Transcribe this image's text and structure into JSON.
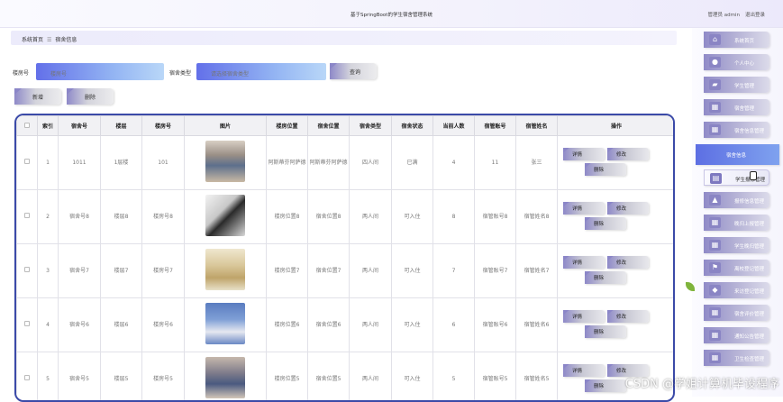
{
  "header": {
    "title": "基于SpringBoot的学生宿舍管理系统",
    "admin": "管理员 admin",
    "logout": "退出登录"
  },
  "breadcrumb": {
    "home": "系统首页",
    "sep": "☰",
    "current": "宿舍信息"
  },
  "search": {
    "room_label": "楼房号",
    "room_placeholder": "楼房号",
    "type_label": "宿舍类型",
    "type_placeholder": "请选择宿舍类型",
    "query": "查询"
  },
  "actions": {
    "add": "新增",
    "delete": "删除"
  },
  "table": {
    "columns": [
      "索引",
      "宿舍号",
      "楼层",
      "楼房号",
      "图片",
      "楼房位置",
      "宿舍位置",
      "宿舍类型",
      "宿舍状态",
      "当前人数",
      "宿管账号",
      "宿管姓名",
      "操作"
    ],
    "rows": [
      {
        "idx": "1",
        "room": "1011",
        "floor": "1层楼",
        "building": "101",
        "photo": "room-photo-1",
        "bpos": "阿斯蒂芬阿萨德",
        "rpos": "阿斯蒂芬阿萨德",
        "type": "四人间",
        "status": "已满",
        "count": "4",
        "acct": "11",
        "name": "张三"
      },
      {
        "idx": "2",
        "room": "宿舍号8",
        "floor": "楼层8",
        "building": "楼房号8",
        "photo": "room-photo-2",
        "bpos": "楼房位置8",
        "rpos": "宿舍位置8",
        "type": "两人间",
        "status": "可入住",
        "count": "8",
        "acct": "宿管账号8",
        "name": "宿管姓名8"
      },
      {
        "idx": "3",
        "room": "宿舍号7",
        "floor": "楼层7",
        "building": "楼房号7",
        "photo": "room-photo-3",
        "bpos": "楼房位置7",
        "rpos": "宿舍位置7",
        "type": "两人间",
        "status": "可入住",
        "count": "7",
        "acct": "宿管账号7",
        "name": "宿管姓名7"
      },
      {
        "idx": "4",
        "room": "宿舍号6",
        "floor": "楼层6",
        "building": "楼房号6",
        "photo": "room-photo-4",
        "bpos": "楼房位置6",
        "rpos": "宿舍位置6",
        "type": "两人间",
        "status": "可入住",
        "count": "6",
        "acct": "宿管账号6",
        "name": "宿管姓名6"
      },
      {
        "idx": "5",
        "room": "宿舍号5",
        "floor": "楼层5",
        "building": "楼房号5",
        "photo": "room-photo-5",
        "bpos": "楼房位置5",
        "rpos": "宿舍位置5",
        "type": "两人间",
        "status": "可入住",
        "count": "5",
        "acct": "宿管账号5",
        "name": "宿管姓名5"
      }
    ],
    "ops": {
      "detail": "详情",
      "edit": "修改",
      "delete": "删除"
    }
  },
  "sidebar": {
    "items": [
      {
        "label": "系统首页",
        "icon": "home-icon"
      },
      {
        "label": "个人中心",
        "icon": "user-icon"
      },
      {
        "label": "学生管理",
        "icon": "student-icon"
      },
      {
        "label": "宿舍管理",
        "icon": "grid-icon"
      },
      {
        "label": "宿舍信息管理",
        "icon": "grid-icon"
      },
      {
        "label": "宿舍信息",
        "icon": ""
      },
      {
        "label": "学生报修管理",
        "icon": "doc-icon"
      },
      {
        "label": "报修信息管理",
        "icon": "tool-icon"
      },
      {
        "label": "晚归上报管理",
        "icon": "grid-icon"
      },
      {
        "label": "学生晚归管理",
        "icon": "grid-icon"
      },
      {
        "label": "离校登记管理",
        "icon": "flag-icon"
      },
      {
        "label": "来访登记管理",
        "icon": "chat-icon"
      },
      {
        "label": "宿舍评价管理",
        "icon": "grid-icon"
      },
      {
        "label": "通知公告管理",
        "icon": "grid-icon"
      },
      {
        "label": "卫生检查管理",
        "icon": "grid-icon"
      }
    ]
  },
  "watermark": "CSDN @学姐计算机毕设程序",
  "colors": {
    "accent": "#5d6fe3",
    "button": "#8e89c8",
    "table_border": "#3b4aa8"
  }
}
